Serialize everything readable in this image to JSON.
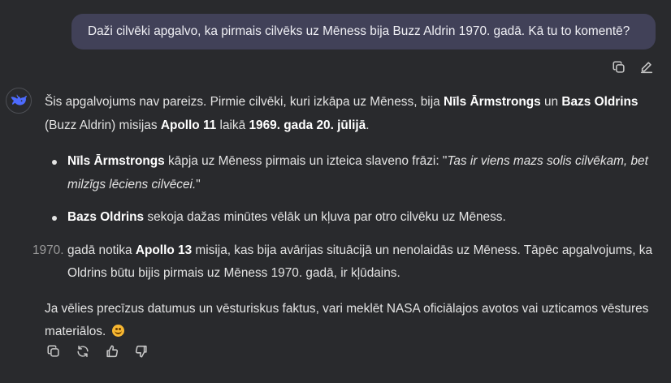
{
  "user_message": {
    "text": "Daži cilvēki apgalvo, ka pirmais cilvēks uz Mēness bija Buzz Aldrin 1970. gadā. Kā tu to komentē?"
  },
  "user_actions": {
    "copy_icon": "copy-icon",
    "edit_icon": "pencil-icon"
  },
  "assistant": {
    "avatar_icon": "whale-logo-icon",
    "p1": {
      "t1": "Šis apgalvojums nav pareizs. Pirmie cilvēki, kuri izkāpa uz Mēness, bija ",
      "b1": "Nīls Ārmstrongs",
      "t2": " un ",
      "b2": "Bazs Oldrins",
      "t3": " (Buzz Aldrin) misijas ",
      "b3": "Apollo 11",
      "t4": " laikā ",
      "b4": "1969. gada 20. jūlijā",
      "t5": "."
    },
    "bullets": [
      {
        "bold": "Nīls Ārmstrongs",
        "text": " kāpja uz Mēness pirmais un izteica slaveno frāzi: \"",
        "italic": "Tas ir viens mazs solis cilvēkam, bet milzīgs lēciens cilvēcei.",
        "end": "\""
      },
      {
        "bold": "Bazs Oldrins",
        "text": " sekoja dažas minūtes vēlāk un kļuva par otro cilvēku uz Mēness."
      }
    ],
    "numbered": {
      "num": "1970.",
      "t1": " gadā notika ",
      "b1": "Apollo 13",
      "t2": " misija, kas bija avārijas situācijā un nenolaidās uz Mēness. Tāpēc apgalvojums, ka Oldrins būtu bijis pirmais uz Mēness 1970. gadā, ir kļūdains."
    },
    "last": {
      "text": "Ja vēlies precīzus datumus un vēsturiskus faktus, vari meklēt NASA oficiālajos avotos vai uzticamos vēstures materiālos. ",
      "emoji": "smiling-face-emoji"
    }
  },
  "assistant_actions": [
    "copy-icon",
    "regenerate-icon",
    "thumbs-up-icon",
    "thumbs-down-icon"
  ],
  "colors": {
    "background": "#292a2d",
    "user_bubble": "#414158",
    "text": "#e3e3e3",
    "bold_text": "#ffffff",
    "logo_blue": "#4d6bfe"
  }
}
